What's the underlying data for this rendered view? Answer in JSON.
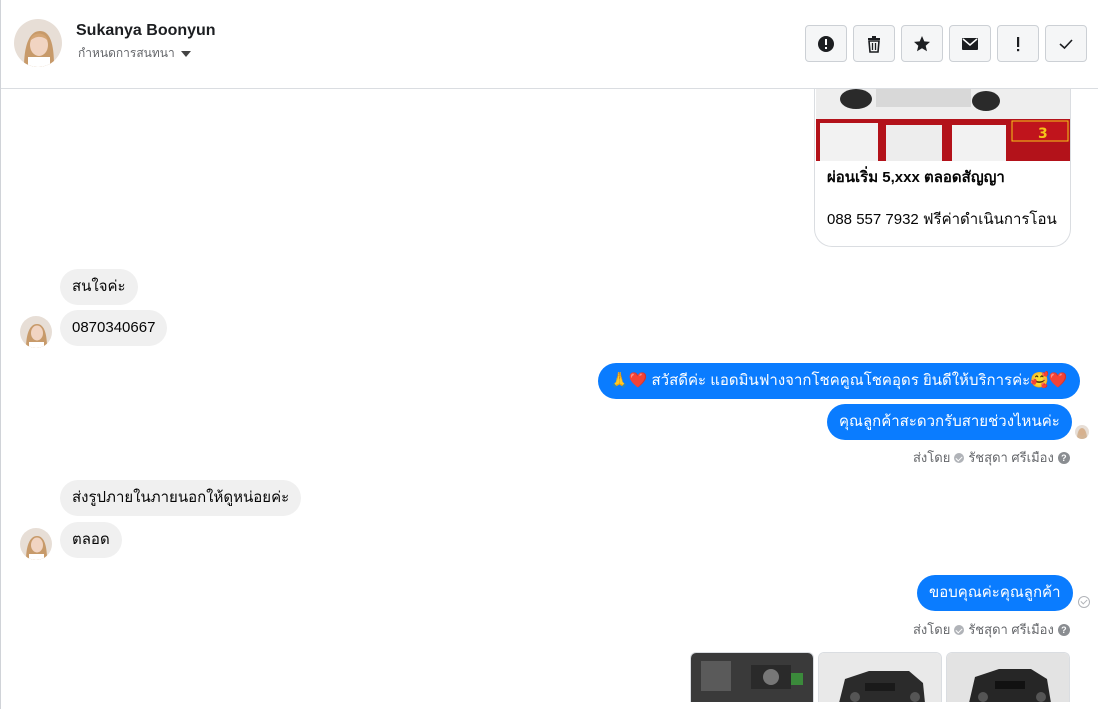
{
  "header": {
    "contact_name": "Sukanya Boonyun",
    "subtitle": "กำหนดการสนทนา",
    "actions": [
      {
        "icon": "alert-circle-icon",
        "label": "report"
      },
      {
        "icon": "trash-icon",
        "label": "delete"
      },
      {
        "icon": "star-icon",
        "label": "star"
      },
      {
        "icon": "envelope-icon",
        "label": "mark-unread"
      },
      {
        "icon": "exclamation-icon",
        "label": "spam"
      },
      {
        "icon": "check-icon",
        "label": "done"
      }
    ]
  },
  "card": {
    "title": "ผ่อนเริ่ม 5,xxx ตลอดสัญญา",
    "subtitle": "088 557 7932 ฟรีค่าดำเนินการโอน"
  },
  "messages": {
    "in1": "สนใจค่ะ",
    "in2": "0870340667",
    "out1": "🙏❤️ สวัสดีค่ะ แอดมินฟางจากโชคคูณโชคอุดร ยินดีให้บริการค่ะ🥰❤️",
    "out2": "คุณลูกค้าสะดวกรับสายช่วงไหนค่ะ",
    "meta1": {
      "prefix": "ส่งโดย",
      "sender": "รัชสุดา ศรีเมือง"
    },
    "in3": "ส่งรูปภายในภายนอกให้ดูหน่อยค่ะ",
    "in4": "ตลอด",
    "out3": "ขอบคุณค่ะคุณลูกค้า",
    "meta2": {
      "prefix": "ส่งโดย",
      "sender": "รัชสุดา ศรีเมือง"
    }
  },
  "colors": {
    "outgoing_bubble": "#0a7cff",
    "incoming_bubble": "#f0f0f0"
  }
}
